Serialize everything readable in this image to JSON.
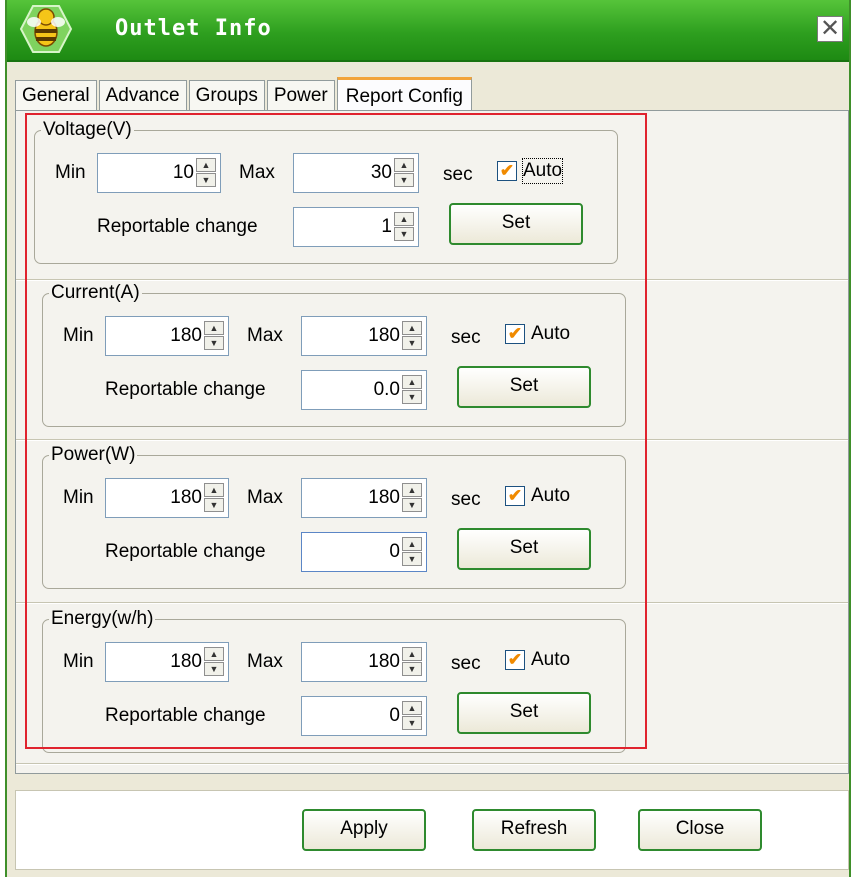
{
  "window": {
    "title": "Outlet Info",
    "close_glyph": "✕",
    "app_icon": "bee-icon"
  },
  "tabs": [
    "General",
    "Advance",
    "Groups",
    "Power",
    "Report Config"
  ],
  "active_tab": "Report Config",
  "groups": [
    {
      "legend": "Voltage(V)",
      "min_label": "Min",
      "min": "10",
      "max_label": "Max",
      "max": "30",
      "sec_label": "sec",
      "auto_label": "Auto",
      "auto_checked": true,
      "change_label": "Reportable change",
      "change": "1",
      "set_label": "Set"
    },
    {
      "legend": "Current(A)",
      "min_label": "Min",
      "min": "180",
      "max_label": "Max",
      "max": "180",
      "sec_label": "sec",
      "auto_label": "Auto",
      "auto_checked": true,
      "change_label": "Reportable change",
      "change": "0.0",
      "set_label": "Set"
    },
    {
      "legend": "Power(W)",
      "min_label": "Min",
      "min": "180",
      "max_label": "Max",
      "max": "180",
      "sec_label": "sec",
      "auto_label": "Auto",
      "auto_checked": true,
      "change_label": "Reportable change",
      "change": "0",
      "set_label": "Set"
    },
    {
      "legend": "Energy(w/h)",
      "min_label": "Min",
      "min": "180",
      "max_label": "Max",
      "max": "180",
      "sec_label": "sec",
      "auto_label": "Auto",
      "auto_checked": true,
      "change_label": "Reportable change",
      "change": "0",
      "set_label": "Set"
    }
  ],
  "footer": {
    "apply": "Apply",
    "refresh": "Refresh",
    "close": "Close"
  },
  "colors": {
    "title_bar": "#2e9f1f",
    "highlight_box": "#e0232e",
    "check_mark": "#f08a00"
  }
}
